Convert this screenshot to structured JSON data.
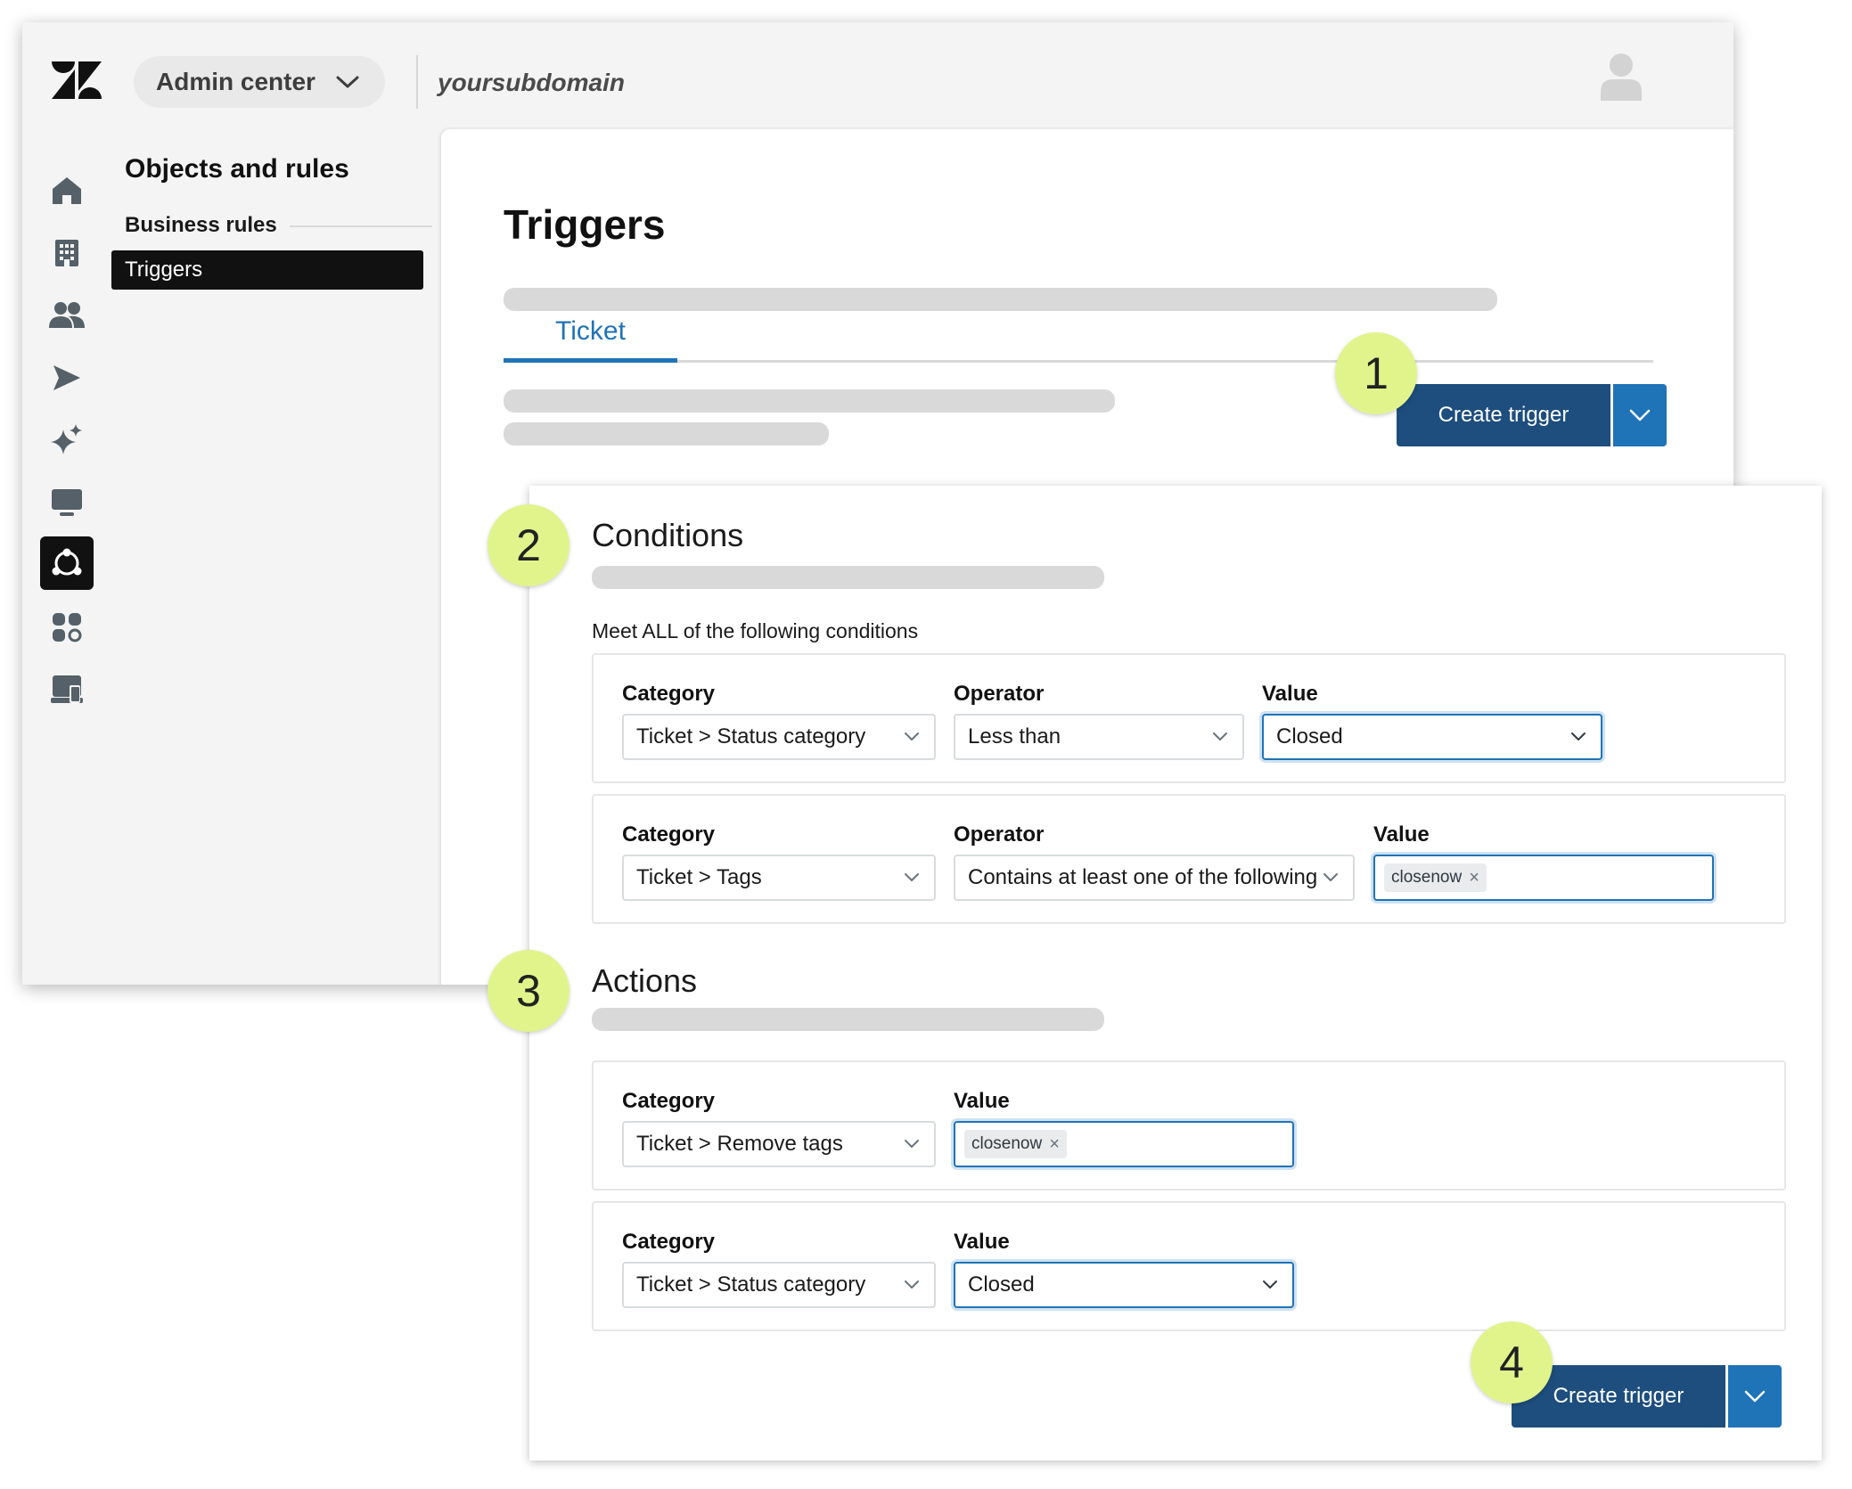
{
  "header": {
    "product_switcher": "Admin center",
    "subdomain": "yoursubdomain"
  },
  "sidebar": {
    "icons": [
      "home-icon",
      "building-icon",
      "people-icon",
      "send-icon",
      "sparkle-icon",
      "monitor-icon",
      "objects-rules-icon",
      "apps-icon",
      "workspace-icon"
    ],
    "active": "objects-rules-icon"
  },
  "secondary_nav": {
    "title": "Objects and rules",
    "group": "Business rules",
    "active_item": "Triggers"
  },
  "main": {
    "title": "Triggers",
    "tab": "Ticket",
    "create_button": "Create trigger"
  },
  "steps": [
    "1",
    "2",
    "3",
    "4"
  ],
  "conditions": {
    "title": "Conditions",
    "meet_text": "Meet ALL of the following conditions",
    "rows": [
      {
        "category_label": "Category",
        "category": "Ticket > Status category",
        "operator_label": "Operator",
        "operator": "Less than",
        "value_label": "Value",
        "value": "Closed"
      },
      {
        "category_label": "Category",
        "category": "Ticket > Tags",
        "operator_label": "Operator",
        "operator": "Contains at least one of the following",
        "value_label": "Value",
        "tag": "closenow"
      }
    ]
  },
  "actions": {
    "title": "Actions",
    "rows": [
      {
        "category_label": "Category",
        "category": "Ticket > Remove tags",
        "value_label": "Value",
        "tag": "closenow"
      },
      {
        "category_label": "Category",
        "category": "Ticket > Status category",
        "value_label": "Value",
        "value": "Closed"
      }
    ]
  },
  "footer": {
    "create_button": "Create trigger"
  },
  "colors": {
    "primary_dark": "#1d4e7e",
    "primary": "#1f73b7",
    "step_badge": "#e1f48c",
    "nav_active": "#111111"
  }
}
